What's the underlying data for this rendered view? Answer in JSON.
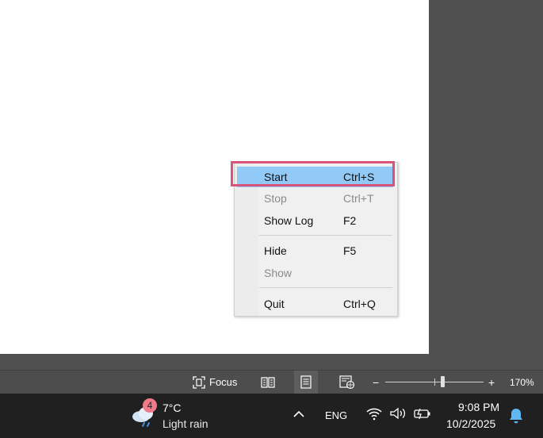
{
  "context_menu": {
    "items": [
      {
        "label": "Start",
        "shortcut": "Ctrl+S",
        "enabled": true,
        "highlighted": true
      },
      {
        "label": "Stop",
        "shortcut": "Ctrl+T",
        "enabled": false
      },
      {
        "label": "Show Log",
        "shortcut": "F2",
        "enabled": true
      },
      {
        "label": "Hide",
        "shortcut": "F5",
        "enabled": true
      },
      {
        "label": "Show",
        "shortcut": "",
        "enabled": false
      },
      {
        "label": "Quit",
        "shortcut": "Ctrl+Q",
        "enabled": true
      }
    ],
    "highlight_color": "#91c9f7",
    "focus_ring_color": "#d9547a"
  },
  "status_bar": {
    "focus_label": "Focus",
    "zoom_minus": "−",
    "zoom_plus": "+",
    "zoom_level": "170%"
  },
  "taskbar": {
    "weather": {
      "badge": "4",
      "temperature": "7°C",
      "condition": "Light rain",
      "icon": "weather-cloud-rain-icon"
    },
    "language": "ENG",
    "time": "9:08 PM",
    "date": "10/2/2025",
    "tray_icons": [
      "chevron-up-icon",
      "wifi-icon",
      "volume-icon",
      "battery-icon",
      "bell-icon"
    ]
  }
}
